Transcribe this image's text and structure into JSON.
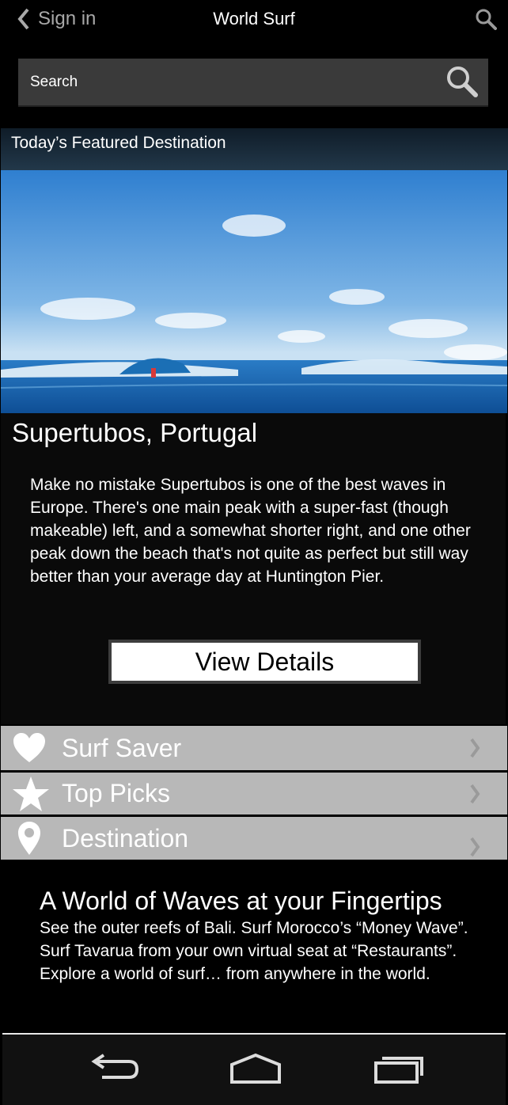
{
  "header": {
    "back_label": "Sign in",
    "title": "World Surf"
  },
  "search": {
    "placeholder": "Search"
  },
  "featured": {
    "heading": "Today’s Featured Destination",
    "destination": "Supertubos, Portugal",
    "description": "Make no mistake Supertubos is one of the best waves in Europe. There's one main peak with a super-fast (though makeable) left, and a somewhat shorter right, and one other peak down the beach that's not quite as perfect but still way better than your average day at Huntington Pier.",
    "button_label": "View Details"
  },
  "menu": [
    {
      "label": "Surf Saver",
      "icon": "heart-icon"
    },
    {
      "label": "Top Picks",
      "icon": "star-icon"
    },
    {
      "label": "Destination",
      "icon": "map-pin-icon"
    }
  ],
  "promo": {
    "title": "A World of Waves at your Fingertips",
    "text": "See the outer reefs of Bali. Surf Morocco’s “Money Wave”. Surf Tavarua from your own virtual seat at “Restaurants”. Explore a world of surf… from anywhere in the world."
  },
  "nav": [
    "back-nav-icon",
    "home-nav-icon",
    "recent-apps-icon"
  ],
  "colors": {
    "background": "#000000",
    "menu_bg": "#b8b8b8",
    "search_bg": "#3a3a3a"
  }
}
